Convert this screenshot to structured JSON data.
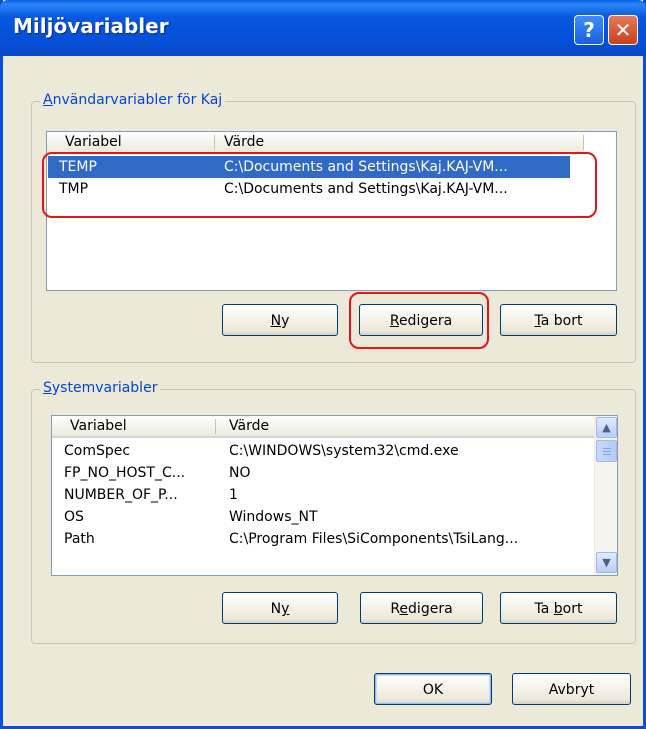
{
  "window": {
    "title": "Miljövariabler",
    "help_icon": "?",
    "close_icon": "✕"
  },
  "user_vars": {
    "group_label_underlined": "A",
    "group_label_rest": "nvändarvariabler för Kaj",
    "columns": [
      "Variabel",
      "Värde"
    ],
    "rows": [
      {
        "name": "TEMP",
        "value": "C:\\Documents and Settings\\Kaj.KAJ-VM...",
        "selected": true
      },
      {
        "name": "TMP",
        "value": "C:\\Documents and Settings\\Kaj.KAJ-VM...",
        "selected": false
      }
    ],
    "buttons": {
      "new_pre": "",
      "new_u": "N",
      "new_post": "y",
      "edit_pre": "",
      "edit_u": "R",
      "edit_post": "edigera",
      "delete_pre": "",
      "delete_u": "T",
      "delete_post": "a bort"
    }
  },
  "system_vars": {
    "group_label_underlined": "S",
    "group_label_rest": "ystemvariabler",
    "columns": [
      "Variabel",
      "Värde"
    ],
    "rows": [
      {
        "name": "ComSpec",
        "value": "C:\\WINDOWS\\system32\\cmd.exe"
      },
      {
        "name": "FP_NO_HOST_C...",
        "value": "NO"
      },
      {
        "name": "NUMBER_OF_P...",
        "value": "1"
      },
      {
        "name": "OS",
        "value": "Windows_NT"
      },
      {
        "name": "Path",
        "value": "C:\\Program Files\\SiComponents\\TsiLang..."
      }
    ],
    "buttons": {
      "new_pre": "N",
      "new_u": "y",
      "new_post": "",
      "edit_pre": "R",
      "edit_u": "e",
      "edit_post": "digera",
      "delete_pre": "Ta ",
      "delete_u": "b",
      "delete_post": "ort"
    }
  },
  "footer": {
    "ok_label": "OK",
    "cancel_label": "Avbryt"
  },
  "colors": {
    "title_bar": "#0550d8",
    "selection": "#316ac5",
    "highlight": "#e0161a",
    "group_label": "#0046d5"
  }
}
